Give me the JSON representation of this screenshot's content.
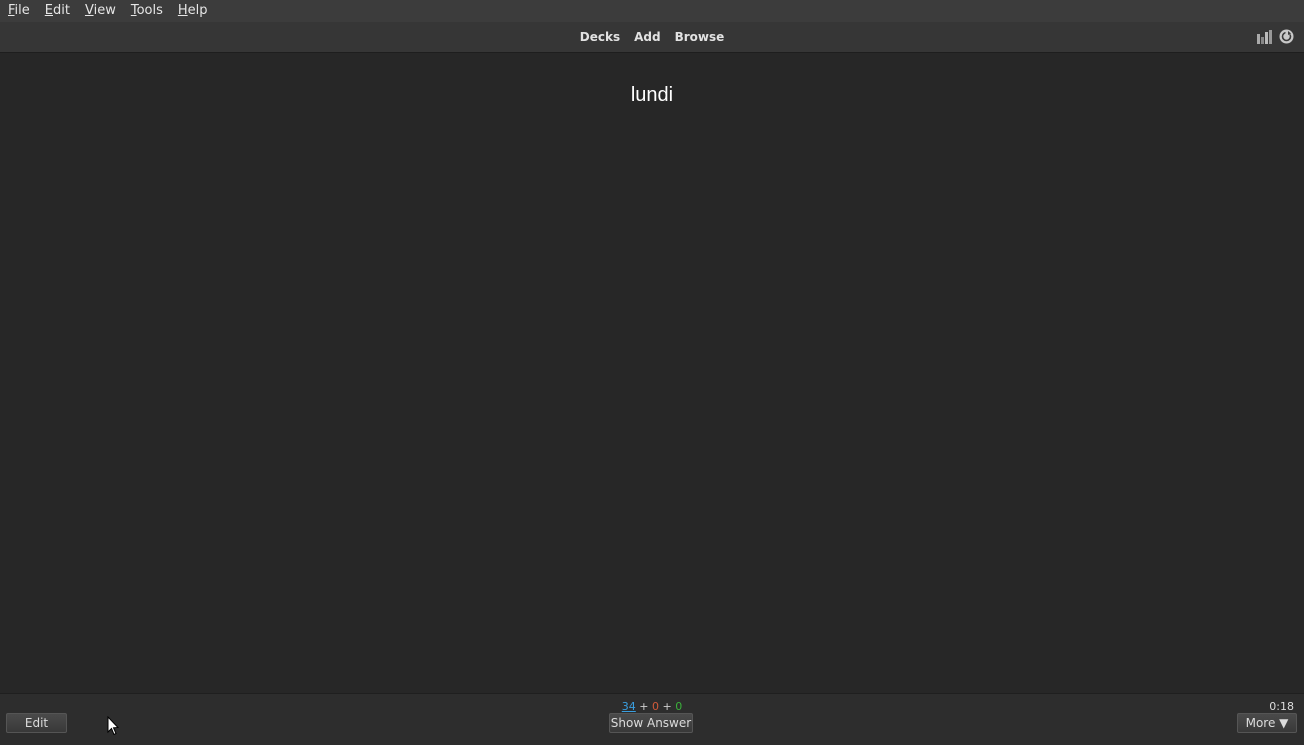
{
  "menubar": {
    "items": [
      {
        "label": "File",
        "mnemonic": "F",
        "rest": "ile"
      },
      {
        "label": "Edit",
        "mnemonic": "E",
        "rest": "dit"
      },
      {
        "label": "View",
        "mnemonic": "V",
        "rest": "iew"
      },
      {
        "label": "Tools",
        "mnemonic": "T",
        "rest": "ools"
      },
      {
        "label": "Help",
        "mnemonic": "H",
        "rest": "elp"
      }
    ]
  },
  "toolbar": {
    "decks": "Decks",
    "add": "Add",
    "browse": "Browse",
    "stats_icon": "bar-chart-icon",
    "sync_icon": "sync-icon"
  },
  "card": {
    "front": "lundi"
  },
  "bottom": {
    "edit_label": "Edit",
    "show_answer_label": "Show Answer",
    "more_label": "More ▼",
    "counts": {
      "new": "34",
      "learn": "0",
      "review": "0",
      "sep": "+"
    },
    "timer": "0:18"
  },
  "colors": {
    "background": "#272727",
    "new_count": "#3a9fe0",
    "learn_count": "#d05a3a",
    "review_count": "#3ab03a"
  }
}
